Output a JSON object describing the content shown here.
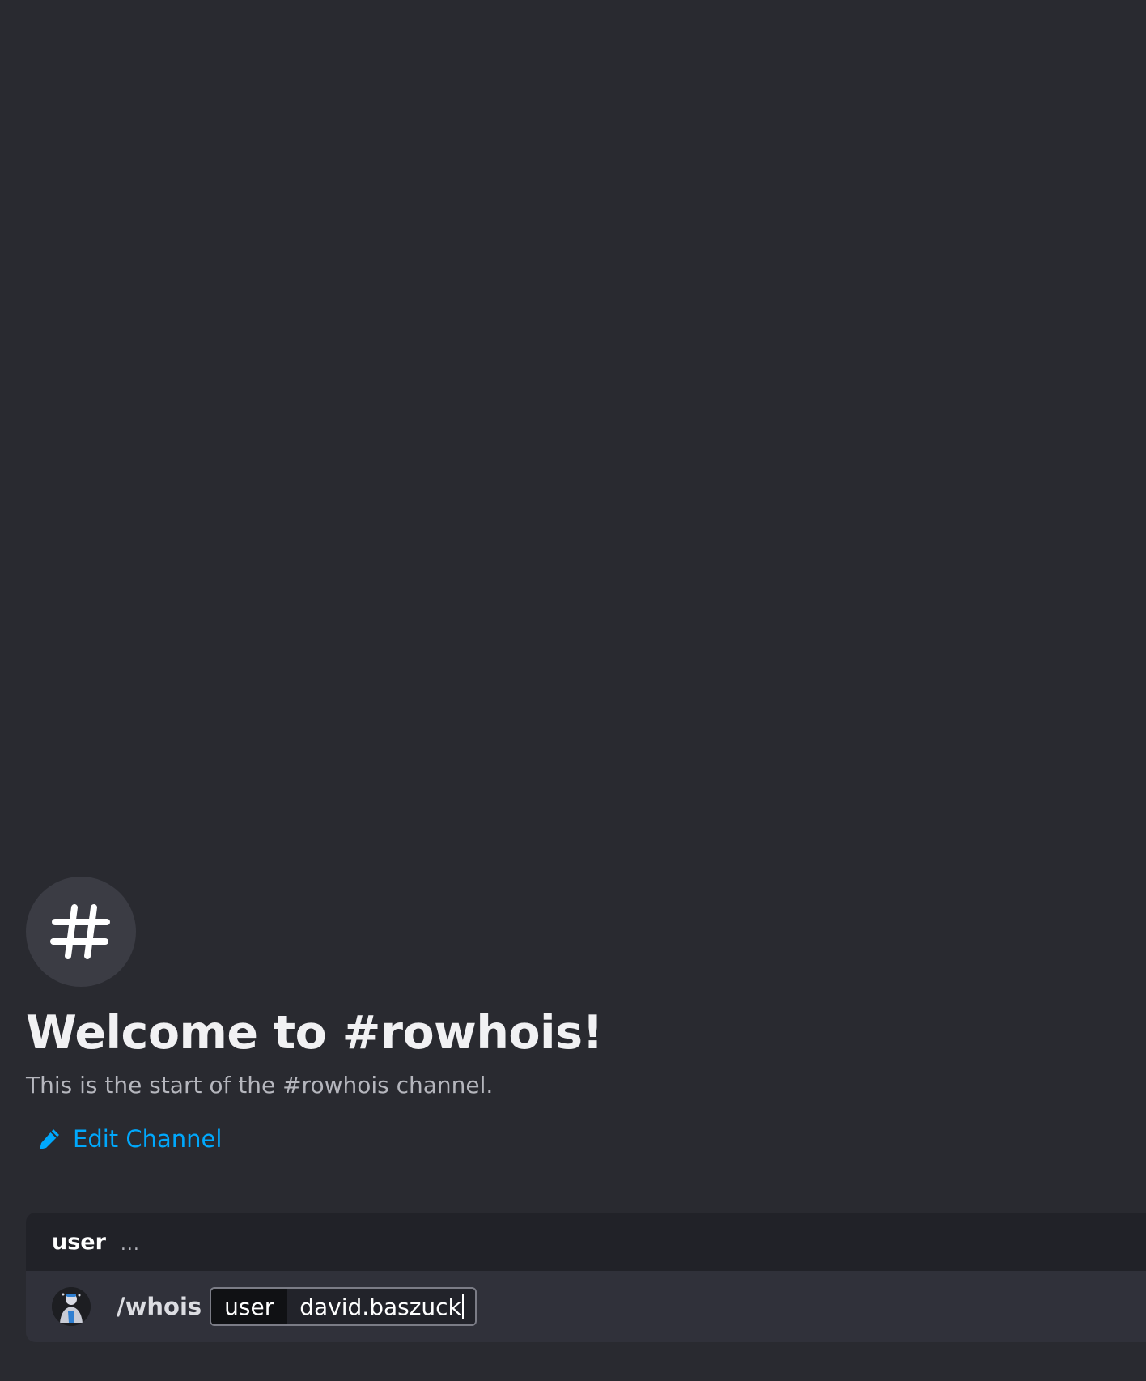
{
  "channel": {
    "icon": "hash-icon",
    "welcome_title": "Welcome to #rowhois!",
    "welcome_subtitle": "This is the start of the #rowhois channel.",
    "edit_label": "Edit Channel",
    "edit_icon": "pencil-icon"
  },
  "composer": {
    "option_hint": {
      "label": "user",
      "description": "..."
    },
    "command": "/whois",
    "option_key": "user",
    "option_value": "david.baszuck"
  },
  "colors": {
    "background": "#292a30",
    "link": "#00a8fc",
    "composer": "#30313a"
  }
}
